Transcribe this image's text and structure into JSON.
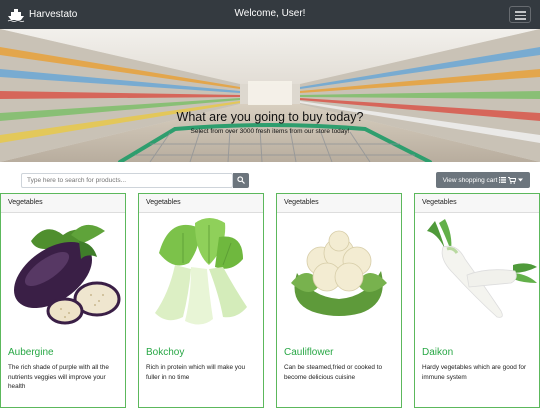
{
  "navbar": {
    "brand": "Harvestato",
    "welcome": "Welcome, User!",
    "menu_icon": "hamburger-icon",
    "brand_icon": "ship-icon"
  },
  "hero": {
    "title": "What are you going to buy today?",
    "subtitle": "Select from over 3000 fresh items from our store today!"
  },
  "search": {
    "placeholder": "Type here to search for products...",
    "icon": "search-icon"
  },
  "cart": {
    "label": "View shopping cart",
    "icons": [
      "list-icon",
      "cart-icon",
      "caret-down-icon"
    ]
  },
  "products": [
    {
      "category": "Vegetables",
      "name": "Aubergine",
      "description": "The rich shade of purple with all the nutrients veggies will improve your health",
      "image": "aubergine-image"
    },
    {
      "category": "Vegetables",
      "name": "Bokchoy",
      "description": "Rich in protein which will make you fuller in no time",
      "image": "bokchoy-image"
    },
    {
      "category": "Vegetables",
      "name": "Cauliflower",
      "description": "Can be steamed,fried or cooked to become delicious cuisine",
      "image": "cauliflower-image"
    },
    {
      "category": "Vegetables",
      "name": "Daikon",
      "description": "Hardy vegetables which are good for immune system",
      "image": "daikon-image"
    }
  ],
  "colors": {
    "navbar": "#343a40",
    "accent": "#28a745",
    "card_border": "#5cb85c",
    "button": "#6c757d"
  }
}
